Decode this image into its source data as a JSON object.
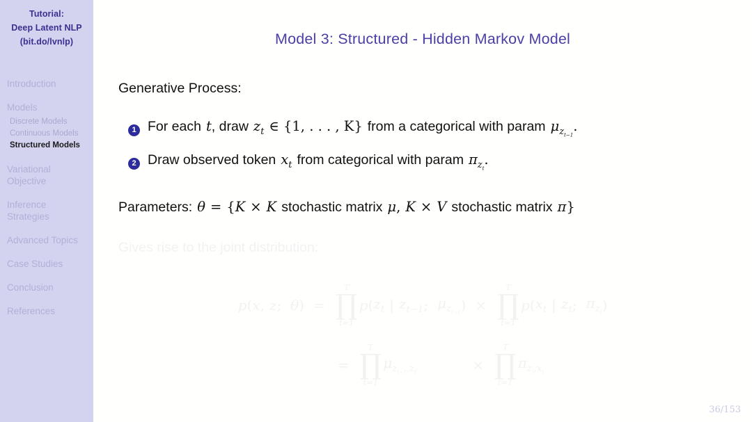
{
  "sidebar": {
    "title_lines": [
      "Tutorial:",
      "Deep Latent NLP",
      "(bit.do/lvnlp)"
    ],
    "sections": [
      {
        "label": "Introduction",
        "lines": [
          "Introduction"
        ],
        "active": false,
        "subitems": []
      },
      {
        "label": "Models",
        "lines": [
          "Models"
        ],
        "active": false,
        "subitems": [
          {
            "label": "Discrete Models",
            "active": false
          },
          {
            "label": "Continuous Models",
            "active": false
          },
          {
            "label": "Structured Models",
            "active": true
          }
        ]
      },
      {
        "label": "Variational Objective",
        "lines": [
          "Variational",
          "Objective"
        ],
        "active": false,
        "subitems": []
      },
      {
        "label": "Inference Strategies",
        "lines": [
          "Inference",
          "Strategies"
        ],
        "active": false,
        "subitems": []
      },
      {
        "label": "Advanced Topics",
        "lines": [
          "Advanced Topics"
        ],
        "active": false,
        "subitems": []
      },
      {
        "label": "Case Studies",
        "lines": [
          "Case Studies"
        ],
        "active": false,
        "subitems": []
      },
      {
        "label": "Conclusion",
        "lines": [
          "Conclusion"
        ],
        "active": false,
        "subitems": []
      },
      {
        "label": "References",
        "lines": [
          "References"
        ],
        "active": false,
        "subitems": []
      }
    ],
    "colors": {
      "background": "#d3d3f0",
      "title": "#3b2f91",
      "item": "#b0b0d8",
      "active": "#1a1a1a"
    }
  },
  "slide": {
    "title": "Model 3: Structured - Hidden Markov Model",
    "title_color": "#4a3fa8",
    "page_number": "36/153",
    "background": "#fffffd"
  },
  "content": {
    "generative_heading": "Generative Process:",
    "items": [
      {
        "number": "1",
        "text_plain": "For each t, draw z_t ∈ {1, …, K} from a categorical with param μ_{z_{t−1}}.",
        "parts": {
          "a": "For each",
          "var_t": "t",
          "b": ", draw",
          "var_z": "z",
          "sub_t": "t",
          "in": "∈ {1, . . . , K}",
          "c": "from a categorical with param",
          "mu": "μ",
          "mu_sub": "z",
          "mu_sub_sub": "t−1",
          "period": "."
        }
      },
      {
        "number": "2",
        "text_plain": "Draw observed token x_t from categorical with param π_{z_t}.",
        "parts": {
          "a": "Draw observed token",
          "var_x": "x",
          "sub_t": "t",
          "b": "from categorical with param",
          "pi": "π",
          "pi_sub": "z",
          "pi_sub_sub": "t",
          "period": "."
        }
      }
    ],
    "parameters": {
      "label": "Parameters:",
      "text_plain": "θ = {K × K stochastic matrix μ, K × V stochastic matrix π}",
      "theta": "θ",
      "eq": "=",
      "open": "{",
      "k1": "K",
      "times1": "×",
      "k2": "K",
      "sto1": "stochastic matrix",
      "mu": "μ",
      "comma": ",",
      "k3": "K",
      "times2": "×",
      "v": "V",
      "sto2": "stochastic matrix",
      "pi": "π",
      "close": "}"
    }
  },
  "faded_content": {
    "note": "Gives rise to the joint distribution:",
    "equation_line1_plain": "p(x, z; θ) = ∏_{t=1}^{T} p(z_t | z_{t−1}; μ_{z_{t−1}}) × ∏_{t=1}^{T} p(x_t | z_t; π_{z_t})",
    "equation_line2_plain": "= ∏_{t=1}^{T} μ_{z_{t−1}, z_t} × ∏_{t=1}^{T} π_{z_t, x_t}",
    "tokens": {
      "p": "p",
      "open_paren": "(",
      "x": "x",
      "comma": ",",
      "z": "z",
      "semi": ";",
      "theta": "θ",
      "close_paren": ")",
      "equals": "=",
      "prod_upper": "T",
      "prod_symbol": "∏",
      "prod_lower": "t=1",
      "mid": "|",
      "times": "×",
      "mu": "μ",
      "pi": "π",
      "sub_t": "t",
      "sub_tm1": "t−1"
    },
    "color": "#f2f2f2"
  }
}
